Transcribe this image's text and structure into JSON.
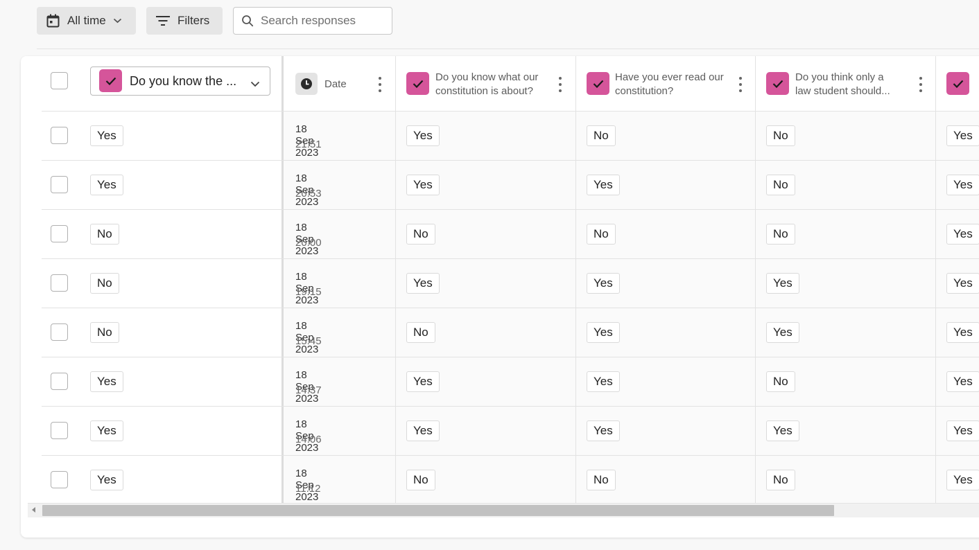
{
  "toolbar": {
    "date_range_label": "All time",
    "filters_label": "Filters",
    "search_placeholder": "Search responses"
  },
  "table": {
    "frozen_column_label": "Do you know the ...",
    "columns": [
      {
        "label": "Date",
        "icon": "clock-icon"
      },
      {
        "label": "Do you know what our constitution is about?",
        "icon": "checkbox-icon"
      },
      {
        "label": "Have you ever read our constitution?",
        "icon": "checkbox-icon"
      },
      {
        "label": "Do you think only a law student should...",
        "icon": "checkbox-icon"
      },
      {
        "label": "",
        "icon": "checkbox-icon"
      }
    ],
    "rows": [
      {
        "first": "Yes",
        "date": "18 Sep 2023",
        "time": "21:51",
        "q1": "Yes",
        "q2": "No",
        "q3": "No",
        "q4": "Yes"
      },
      {
        "first": "Yes",
        "date": "18 Sep 2023",
        "time": "20:53",
        "q1": "Yes",
        "q2": "Yes",
        "q3": "No",
        "q4": "Yes"
      },
      {
        "first": "No",
        "date": "18 Sep 2023",
        "time": "20:00",
        "q1": "No",
        "q2": "No",
        "q3": "No",
        "q4": "Yes"
      },
      {
        "first": "No",
        "date": "18 Sep 2023",
        "time": "19:15",
        "q1": "Yes",
        "q2": "Yes",
        "q3": "Yes",
        "q4": "Yes"
      },
      {
        "first": "No",
        "date": "18 Sep 2023",
        "time": "15:45",
        "q1": "No",
        "q2": "Yes",
        "q3": "Yes",
        "q4": "Yes"
      },
      {
        "first": "Yes",
        "date": "18 Sep 2023",
        "time": "14:37",
        "q1": "Yes",
        "q2": "Yes",
        "q3": "No",
        "q4": "Yes"
      },
      {
        "first": "Yes",
        "date": "18 Sep 2023",
        "time": "14:06",
        "q1": "Yes",
        "q2": "Yes",
        "q3": "Yes",
        "q4": "Yes"
      },
      {
        "first": "Yes",
        "date": "18 Sep 2023",
        "time": "11:12",
        "q1": "No",
        "q2": "No",
        "q3": "No",
        "q4": "Yes"
      }
    ]
  },
  "colors": {
    "accent_pink": "#d5559a",
    "toolbar_button_bg": "#e6e6e6",
    "scrollbar_thumb": "#c1c1c1"
  }
}
